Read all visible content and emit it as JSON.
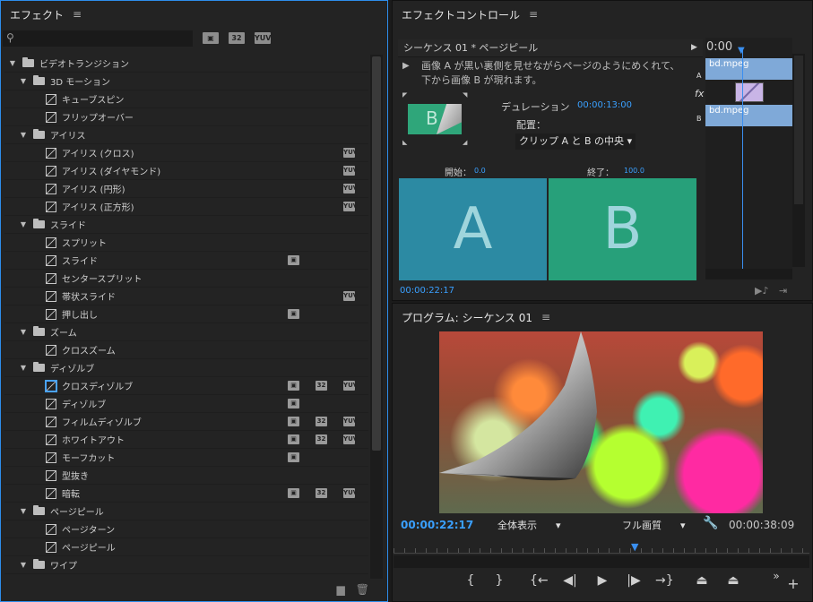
{
  "effects_panel": {
    "title": "エフェクト",
    "filter_badges": [
      "32",
      "YUV"
    ],
    "tree": [
      {
        "type": "folder",
        "level": 0,
        "label": "ビデオトランジション"
      },
      {
        "type": "folder",
        "level": 1,
        "label": "3D モーション"
      },
      {
        "type": "item",
        "level": 2,
        "label": "キューブスピン",
        "badges": []
      },
      {
        "type": "item",
        "level": 2,
        "label": "フリップオーバー",
        "badges": []
      },
      {
        "type": "folder",
        "level": 1,
        "label": "アイリス"
      },
      {
        "type": "item",
        "level": 2,
        "label": "アイリス (クロス)",
        "badges": [
          "yuv"
        ]
      },
      {
        "type": "item",
        "level": 2,
        "label": "アイリス (ダイヤモンド)",
        "badges": [
          "yuv"
        ]
      },
      {
        "type": "item",
        "level": 2,
        "label": "アイリス (円形)",
        "badges": [
          "yuv"
        ]
      },
      {
        "type": "item",
        "level": 2,
        "label": "アイリス (正方形)",
        "badges": [
          "yuv"
        ]
      },
      {
        "type": "folder",
        "level": 1,
        "label": "スライド"
      },
      {
        "type": "item",
        "level": 2,
        "label": "スプリット",
        "badges": []
      },
      {
        "type": "item",
        "level": 2,
        "label": "スライド",
        "badges": [
          "acc"
        ]
      },
      {
        "type": "item",
        "level": 2,
        "label": "センタースプリット",
        "badges": []
      },
      {
        "type": "item",
        "level": 2,
        "label": "帯状スライド",
        "badges": [
          "yuv"
        ]
      },
      {
        "type": "item",
        "level": 2,
        "label": "押し出し",
        "badges": [
          "acc"
        ]
      },
      {
        "type": "folder",
        "level": 1,
        "label": "ズーム"
      },
      {
        "type": "item",
        "level": 2,
        "label": "クロスズーム",
        "badges": []
      },
      {
        "type": "folder",
        "level": 1,
        "label": "ディゾルブ"
      },
      {
        "type": "item",
        "level": 2,
        "label": "クロスディゾルブ",
        "badges": [
          "acc",
          "32",
          "yuv"
        ],
        "selected": true
      },
      {
        "type": "item",
        "level": 2,
        "label": "ディゾルブ",
        "badges": [
          "acc"
        ]
      },
      {
        "type": "item",
        "level": 2,
        "label": "フィルムディゾルブ",
        "badges": [
          "acc",
          "32",
          "yuv"
        ]
      },
      {
        "type": "item",
        "level": 2,
        "label": "ホワイトアウト",
        "badges": [
          "acc",
          "32",
          "yuv"
        ]
      },
      {
        "type": "item",
        "level": 2,
        "label": "モーフカット",
        "badges": [
          "acc"
        ]
      },
      {
        "type": "item",
        "level": 2,
        "label": "型抜き",
        "badges": []
      },
      {
        "type": "item",
        "level": 2,
        "label": "暗転",
        "badges": [
          "acc",
          "32",
          "yuv"
        ]
      },
      {
        "type": "folder",
        "level": 1,
        "label": "ページピール"
      },
      {
        "type": "item",
        "level": 2,
        "label": "ページターン",
        "badges": []
      },
      {
        "type": "item",
        "level": 2,
        "label": "ページピール",
        "badges": []
      },
      {
        "type": "folder",
        "level": 1,
        "label": "ワイプ"
      }
    ]
  },
  "effect_controls": {
    "title": "エフェクトコントロール",
    "sequence_label": "シーケンス 01 * ページピール",
    "description_line1": "画像 A が黒い裏側を見せながらページのようにめくれて、",
    "description_line2": "下から画像 B が現れます。",
    "thumb_letter": "B",
    "duration_label": "デュレーション",
    "duration_value": "00:00:13:00",
    "alignment_label": "配置：",
    "alignment_value": "クリップ A と B の中央",
    "start_label": "開始：",
    "start_value": "0.0",
    "end_label": "終了：",
    "end_value": "100.0",
    "letter_a": "A",
    "letter_b": "B",
    "current_time": "00:00:22:17",
    "timeline_time": "0:00",
    "track_a_label": "A",
    "track_b_label": "B",
    "clip_a_name": "bd.mpeg",
    "clip_b_name": "bd.mpeg",
    "fx_label": "fx"
  },
  "program": {
    "title": "プログラム: シーケンス 01",
    "time_current": "00:00:22:17",
    "time_duration": "00:00:38:09",
    "zoom_value": "全体表示",
    "quality_value": "フル画質"
  },
  "colors": {
    "accent_blue": "#3aa0ff",
    "clip_a_bg": "#2c8aa3",
    "clip_b_bg": "#27a07a"
  }
}
